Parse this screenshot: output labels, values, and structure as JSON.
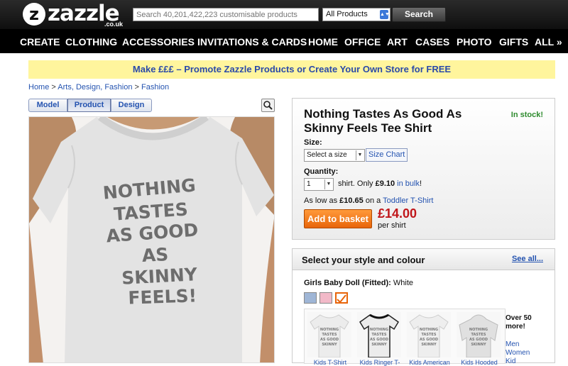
{
  "header": {
    "logo_text": "zazzle",
    "logo_suffix": ".co.uk",
    "search_placeholder": "Search 40,201,422,223 customisable products",
    "search_scope": "All Products",
    "search_button": "Search"
  },
  "nav": {
    "items": [
      "CREATE",
      "CLOTHING",
      "ACCESSORIES",
      "INVITATIONS & CARDS",
      "HOME",
      "OFFICE",
      "ART",
      "CASES",
      "PHOTO",
      "GIFTS",
      "ALL »"
    ]
  },
  "promo": "Make £££ – Promote Zazzle Products or Create Your Own Store for FREE",
  "breadcrumb": [
    "Home",
    "Arts, Design, Fashion",
    "Fashion"
  ],
  "view_tabs": [
    "Model",
    "Product",
    "Design"
  ],
  "shirt_text": [
    "NOTHING",
    "TASTES",
    "AS GOOD",
    "AS",
    "SKINNY",
    "FEELS!"
  ],
  "product": {
    "title_line1": "Nothing Tastes As Good As",
    "title_line2": "Skinny Feels Tee Shirt",
    "stock": "In stock!",
    "size_label": "Size:",
    "size_value": "Select a size",
    "size_chart": "Size Chart",
    "qty_label": "Quantity:",
    "qty_value": "1",
    "qty_text_a": "shirt.  Only ",
    "qty_price": "£9.10",
    "qty_link": "in bulk",
    "qty_text_b": "!",
    "low_text_a": "As low as ",
    "low_price": "£10.65",
    "low_text_b": " on a ",
    "low_link": "Toddler T-Shirt",
    "add_button": "Add to basket",
    "price": "£14.00",
    "per": "per shirt"
  },
  "style": {
    "heading": "Select your style and colour",
    "see_all": "See all...",
    "current_name": "Girls Baby Doll (Fitted):",
    "current_colour": "White",
    "swatch_colors": [
      "#9fb6d6",
      "#f2b9c8",
      "#ffffff"
    ],
    "thumbs": [
      "Kids T-Shirt",
      "Kids Ringer T-",
      "Kids American",
      "Kids Hooded"
    ],
    "more_line1": "Over 50",
    "more_line2": "more!",
    "more_links": [
      "Men",
      "Women",
      "Kid"
    ]
  }
}
